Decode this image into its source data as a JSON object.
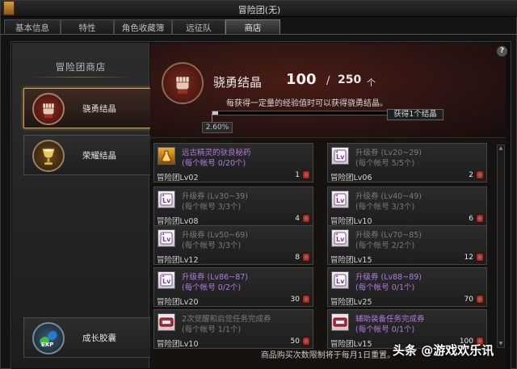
{
  "window": {
    "title": "冒险团(无)"
  },
  "tabs": [
    {
      "label": "基本信息"
    },
    {
      "label": "特性"
    },
    {
      "label": "角色收藏簿"
    },
    {
      "label": "远征队"
    },
    {
      "label": "商店",
      "active": true
    }
  ],
  "sidebar": {
    "title": "冒险团商店",
    "items": [
      {
        "label": "骁勇结晶",
        "icon": "fist-crystal-icon",
        "active": true
      },
      {
        "label": "荣耀结晶",
        "icon": "trophy-cup-icon"
      },
      {
        "label": "成长胶囊",
        "icon": "exp-capsule-icon"
      }
    ]
  },
  "header": {
    "name": "骁勇结晶",
    "count": "100",
    "slash": "/",
    "max": "250",
    "unit": "个",
    "description": "每获得一定量的经验值时可以获得骁勇结晶。",
    "progress_pct_label": "2.60%",
    "progress_fraction": 0.026,
    "progress_label": "获得1个结晶"
  },
  "items": [
    {
      "name": "远古精灵的驮良秘药",
      "limit": "(每个帐号 0/20个)",
      "level": "冒险团Lv02",
      "price": "1",
      "icon": "potion-icon",
      "style": "purple"
    },
    {
      "name": "升级券 (Lv20~29)",
      "limit": "(每个帐号 5/5个)",
      "level": "冒险团Lv06",
      "price": "2",
      "icon": "levelup-ticket-icon",
      "style": "gray"
    },
    {
      "name": "升级券 (Lv30~39)",
      "limit": "(每个帐号 3/3个)",
      "level": "冒险团Lv08",
      "price": "4",
      "icon": "levelup-ticket-icon",
      "style": "gray"
    },
    {
      "name": "升级券 (Lv40~49)",
      "limit": "(每个帐号 3/3个)",
      "level": "冒险团Lv10",
      "price": "6",
      "icon": "levelup-ticket-icon",
      "style": "gray"
    },
    {
      "name": "升级券 (Lv50~69)",
      "limit": "(每个帐号 3/3个)",
      "level": "冒险团Lv12",
      "price": "8",
      "icon": "levelup-ticket-icon",
      "style": "gray"
    },
    {
      "name": "升级券 (Lv70~85)",
      "limit": "(每个帐号 2/2个)",
      "level": "冒险团Lv15",
      "price": "12",
      "icon": "levelup-ticket-icon",
      "style": "gray"
    },
    {
      "name": "升级券 (Lv86~87)",
      "limit": "(每个帐号 0/2个)",
      "level": "冒险团Lv20",
      "price": "30",
      "icon": "levelup-ticket-icon",
      "style": "purple"
    },
    {
      "name": "升级券 (Lv88~89)",
      "limit": "(每个帐号 0/1个)",
      "level": "冒险团Lv25",
      "price": "70",
      "icon": "levelup-ticket-icon",
      "style": "purple"
    },
    {
      "name": "2次觉醒和启觉任务完成券",
      "limit": "(每个帐号 1/1个)",
      "level": "冒险团Lv10",
      "price": "50",
      "icon": "quest-ticket-icon",
      "style": "gray"
    },
    {
      "name": "辅助装备任务完成券",
      "limit": "(每个帐号 0/1个)",
      "level": "冒险团Lv15",
      "price": "100",
      "icon": "quest-ticket-icon",
      "style": "purple"
    }
  ],
  "footer": "商品购买次数限制将于每月1日重置。",
  "watermark": "头条 @游戏欢乐讯"
}
